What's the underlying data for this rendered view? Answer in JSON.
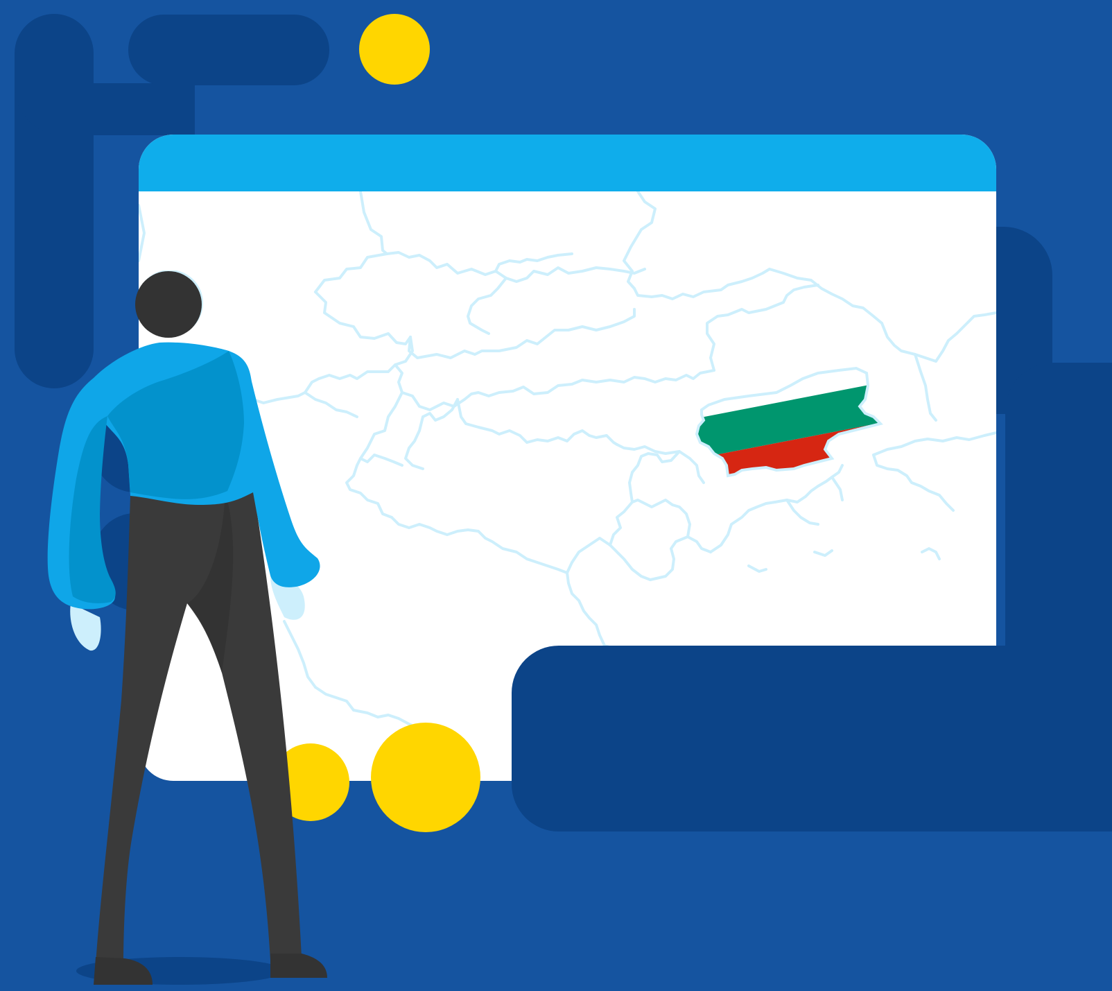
{
  "scene": {
    "background_color": "#1554a0",
    "shadow_color": "#0c4488",
    "accent_dot_color": "#ffd600",
    "window_titlebar_color": "#0fadeb",
    "window_body_color": "#ffffff",
    "map_border_color": "#cdeffc"
  },
  "highlighted_country": {
    "flag_name": "bulgaria-flag",
    "stripe_colors": [
      "#ffffff",
      "#00966e",
      "#d62612"
    ]
  },
  "person": {
    "hair_color": "#333333",
    "shirt_color": "#0fa6e8",
    "shirt_shade_color": "#0392cc",
    "pants_color": "#3a3a3a",
    "hand_color": "#cdeffc"
  }
}
